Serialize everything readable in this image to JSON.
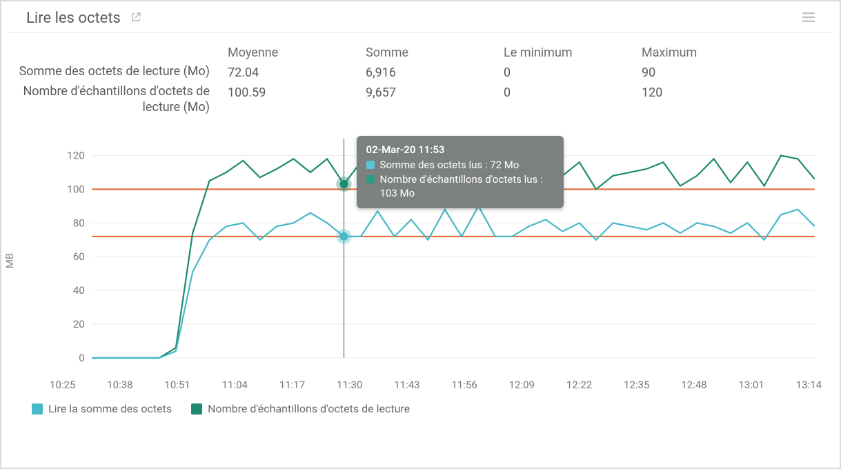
{
  "title": "Lire les octets",
  "stats": {
    "columns": [
      "Moyenne",
      "Somme",
      "Le minimum",
      "Maximum"
    ],
    "rows": [
      {
        "label": "Somme des octets de lecture (Mo)",
        "values": [
          "72.04",
          "6,916",
          "0",
          "90"
        ]
      },
      {
        "label": "Nombre d'échantillons d'octets de lecture (Mo)",
        "values": [
          "100.59",
          "9,657",
          "0",
          "120"
        ]
      }
    ]
  },
  "yaxis": {
    "label": "MB"
  },
  "x_ticks": [
    "10:25",
    "10:38",
    "10:51",
    "11:04",
    "11:17",
    "11:30",
    "11:43",
    "11:56",
    "12:09",
    "12:22",
    "12:35",
    "12:48",
    "13:01",
    "13:14"
  ],
  "tooltip": {
    "title": "02-Mar-20 11:53",
    "lines": [
      "Somme des octets lus : 72 Mo",
      "Nombre d'échantillons d'octets lus : 103 Mo"
    ]
  },
  "legend": {
    "a": "Lire la somme des octets",
    "b": "Nombre d'échantillons d'octets de lecture"
  },
  "chart_data": {
    "type": "line",
    "xlabel": "",
    "ylabel": "MB",
    "ylim": [
      0,
      130
    ],
    "reference_lines": [
      72,
      100
    ],
    "x": [
      "10:25",
      "10:38",
      "10:51",
      "11:04",
      "11:17",
      "11:20",
      "11:23",
      "11:26",
      "11:30",
      "11:33",
      "11:36",
      "11:39",
      "11:43",
      "11:46",
      "11:49",
      "11:53",
      "11:56",
      "11:59",
      "12:02",
      "12:05",
      "12:09",
      "12:12",
      "12:15",
      "12:18",
      "12:22",
      "12:25",
      "12:28",
      "12:31",
      "12:35",
      "12:38",
      "12:41",
      "12:44",
      "12:48",
      "12:51",
      "12:54",
      "12:57",
      "13:01",
      "13:04",
      "13:07",
      "13:10",
      "13:14",
      "13:17",
      "13:20",
      "13:23"
    ],
    "series": [
      {
        "name": "Lire la somme des octets",
        "color": "#47b9c9",
        "values": [
          0,
          0,
          0,
          0,
          0,
          4,
          51,
          70,
          78,
          80,
          70,
          78,
          80,
          86,
          80,
          72,
          72,
          87,
          72,
          82,
          70,
          88,
          72,
          90,
          72,
          72,
          78,
          82,
          75,
          80,
          70,
          80,
          78,
          76,
          80,
          74,
          80,
          78,
          74,
          80,
          70,
          85,
          88,
          78
        ]
      },
      {
        "name": "Nombre d'échantillons d'octets de lecture",
        "color": "#1f8a6f",
        "values": [
          0,
          0,
          0,
          0,
          0,
          6,
          74,
          105,
          110,
          117,
          107,
          112,
          118,
          110,
          118,
          103,
          116,
          100,
          108,
          116,
          103,
          118,
          100,
          120,
          100,
          116,
          100,
          112,
          108,
          116,
          100,
          108,
          110,
          112,
          116,
          102,
          108,
          118,
          104,
          116,
          102,
          120,
          118,
          106
        ]
      }
    ],
    "highlight_x": "11:53"
  }
}
